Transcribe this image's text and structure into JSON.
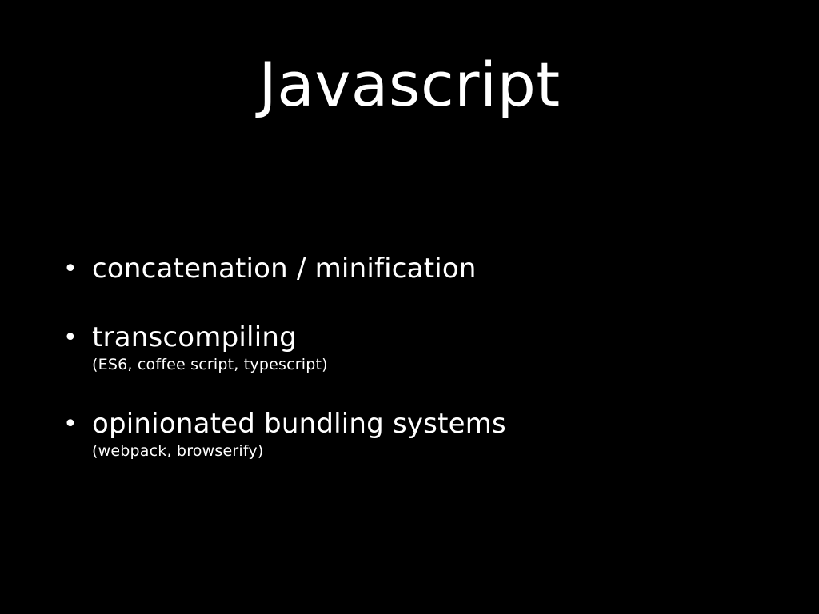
{
  "slide": {
    "title": "Javascript",
    "bullets": [
      {
        "symbol": "•",
        "text": "concatenation / minification",
        "sub": ""
      },
      {
        "symbol": "•",
        "text": "transcompiling",
        "sub": "(ES6, coffee script, typescript)"
      },
      {
        "symbol": "•",
        "text": "opinionated bundling systems",
        "sub": "(webpack, browserify)"
      }
    ],
    "colors": {
      "background": "#000000",
      "text": "#ffffff"
    }
  }
}
